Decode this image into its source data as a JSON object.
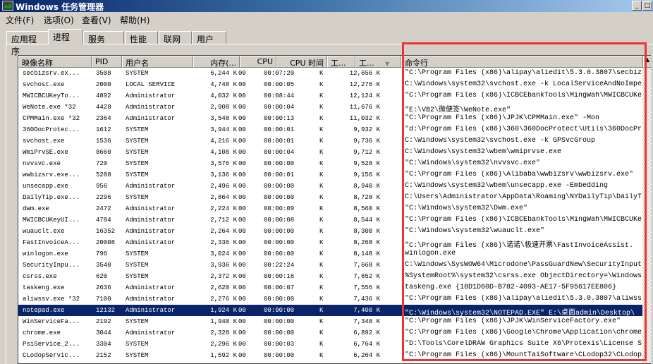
{
  "window": {
    "title": "Windows 任务管理器",
    "minimize": "_",
    "maximize": "□"
  },
  "menu": [
    "文件(F)",
    "选项(O)",
    "查看(V)",
    "帮助(H)"
  ],
  "tabs": [
    "应用程序",
    "进程",
    "服务",
    "性能",
    "联网",
    "用户"
  ],
  "active_tab": "进程",
  "columns": [
    "映像名称",
    "PID",
    "用户名",
    "内存(...",
    "CPU",
    "CPU 时间",
    "工...",
    "工...",
    "命令行"
  ],
  "sort_indicator": "▼",
  "highlight_color": "#ee3333",
  "selection_color": "#0a246a",
  "rows": [
    [
      "secbizsrv.ex...",
      "3508",
      "SYSTEM",
      "6,244 K",
      "00",
      "00:07:20",
      "K",
      "12,656 K",
      "\"C:\\Program Files (x86)\\alipay\\aliedit\\5.3.0.3807\\secbiz"
    ],
    [
      "svchost.exe",
      "2000",
      "LOCAL SERVICE",
      "4,748 K",
      "00",
      "00:00:05",
      "K",
      "12,276 K",
      "C:\\Windows\\system32\\svchost.exe -k LocalServiceAndNoImpe"
    ],
    [
      "MWICBCUKeyTo...",
      "4892",
      "Administrator",
      "4,032 K",
      "00",
      "00:08:44",
      "K",
      "12,124 K",
      "\"C:\\Program Files (x86)\\ICBCEbankTools\\MingWah\\MWICBCUKe"
    ],
    [
      "WeNote.exe *32",
      "4428",
      "Administrator",
      "2,908 K",
      "00",
      "00:00:04",
      "K",
      "11,676 K",
      "\"E:\\VB2\\微便签\\WeNote.exe\""
    ],
    [
      "CPMMain.exe *32",
      "2364",
      "Administrator",
      "3,548 K",
      "00",
      "00:00:13",
      "K",
      "11,032 K",
      "\"C:\\Program Files (x86)\\JPJK\\CPMMain.exe\" -Mon"
    ],
    [
      "360DocProtec...",
      "1612",
      "SYSTEM",
      "3,944 K",
      "00",
      "00:00:01",
      "K",
      "9,932 K",
      "\"d:\\Program Files (x86)\\360\\360DocProtect\\Utils\\360DocPr"
    ],
    [
      "svchost.exe",
      "1536",
      "SYSTEM",
      "4,216 K",
      "00",
      "00:00:01",
      "K",
      "9,736 K",
      "C:\\Windows\\system32\\svchost.exe -k GPSvcGroup"
    ],
    [
      "WmiPrvSE.exe",
      "8660",
      "SYSTEM",
      "4,108 K",
      "00",
      "00:00:04",
      "K",
      "9,712 K",
      "C:\\Windows\\system32\\wbem\\wmiprvse.exe"
    ],
    [
      "nvvsvc.exe",
      "720",
      "SYSTEM",
      "3,576 K",
      "00",
      "00:00:00",
      "K",
      "9,528 K",
      "\"C:\\Windows\\system32\\nvvsvc.exe\""
    ],
    [
      "wwbizsrv.exe...",
      "5288",
      "SYSTEM",
      "3,136 K",
      "00",
      "00:00:01",
      "K",
      "9,156 K",
      "\"C:\\Program Files (x86)\\Alibaba\\wwbizsrv\\wwbizsrv.exe\""
    ],
    [
      "unsecapp.exe",
      "956",
      "Administrator",
      "2,496 K",
      "00",
      "00:00:00",
      "K",
      "8,940 K",
      "C:\\Windows\\system32\\wbem\\unsecapp.exe -Embedding"
    ],
    [
      "DailyTip.exe...",
      "2296",
      "SYSTEM",
      "2,864 K",
      "00",
      "00:00:00",
      "K",
      "8,728 K",
      "C:\\Users\\Administrator\\AppData\\Roaming\\NYDailyTip\\DailyT"
    ],
    [
      "dwm.exe",
      "2472",
      "Administrator",
      "2,224 K",
      "00",
      "00:00:09",
      "K",
      "8,560 K",
      "\"C:\\Windows\\system32\\Dwm.exe\""
    ],
    [
      "MWICBCUKeyUI...",
      "4784",
      "Administrator",
      "2,712 K",
      "00",
      "00:00:08",
      "K",
      "8,544 K",
      "\"C:\\Program Files (x86)\\ICBCEbankTools\\MingWah\\MWICBCUKe"
    ],
    [
      "wuauclt.exe",
      "16352",
      "Administrator",
      "2,264 K",
      "00",
      "00:00:00",
      "K",
      "8,300 K",
      "\"C:\\Windows\\system32\\wuauclt.exe\""
    ],
    [
      "FastInvoiceA...",
      "20008",
      "Administrator",
      "2,336 K",
      "00",
      "00:00:00",
      "K",
      "8,268 K",
      "\"C:\\Program Files (x86)\\诺诺\\极速开票\\FastInvoiceAssist."
    ],
    [
      "winlogon.exe",
      "796",
      "SYSTEM",
      "3,024 K",
      "00",
      "00:00:00",
      "K",
      "8,148 K",
      "winlogon.exe"
    ],
    [
      "SecurityInpu...",
      "3540",
      "SYSTEM",
      "3,936 K",
      "00",
      "00:22:24",
      "K",
      "7,668 K",
      "C:\\Windows\\SysWOW64\\Microdone\\PassGuardNew\\SecurityInput"
    ],
    [
      "csrss.exe",
      "620",
      "SYSTEM",
      "2,372 K",
      "00",
      "00:00:16",
      "K",
      "7,652 K",
      "%SystemRoot%\\system32\\csrss.exe ObjectDirectory=\\Windows"
    ],
    [
      "taskeng.exe",
      "2636",
      "Administrator",
      "2,620 K",
      "00",
      "00:00:07",
      "K",
      "7,556 K",
      "taskeng.exe {18D1D60D-B782-4093-AE17-5F95617EE806}"
    ],
    [
      "aliwssv.exe *32",
      "7100",
      "Administrator",
      "2,276 K",
      "00",
      "00:00:00",
      "K",
      "7,436 K",
      "\"C:\\Program Files (x86)\\alipay\\aliedit\\5.3.0.3807\\aliwss"
    ],
    [
      "notepad.exe",
      "12132",
      "Administrator",
      "1,924 K",
      "00",
      "00:00:00",
      "K",
      "7,400 K",
      "\"C:\\Windows\\system32\\NOTEPAD.EXE\" E:\\桌面admin\\Desktop\\"
    ],
    [
      "WinServiceFa...",
      "2192",
      "SYSTEM",
      "1,940 K",
      "00",
      "00:00:00",
      "K",
      "7,348 K",
      "\"C:\\Program Files (x86)\\JPJK\\WinServiceFactory.exe\""
    ],
    [
      "chrome.exe",
      "3044",
      "Administrator",
      "2,328 K",
      "00",
      "00:00:00",
      "K",
      "6,892 K",
      "\"C:\\Program Files (x86)\\Google\\Chrome\\Application\\chrome"
    ],
    [
      "PsiService_2...",
      "3304",
      "SYSTEM",
      "2,296 K",
      "00",
      "00:00:03",
      "K",
      "6,764 K",
      "\"D:\\Tools\\CorelDRAW Graphics Suite X6\\Protexis\\License S"
    ],
    [
      "CLodopServic...",
      "2152",
      "SYSTEM",
      "1,592 K",
      "00",
      "00:00:00",
      "K",
      "6,264 K",
      "\"C:\\Program Files (x86)\\MountTaiSoftware\\CLodop32\\CLodop"
    ]
  ],
  "selected_row": 21
}
